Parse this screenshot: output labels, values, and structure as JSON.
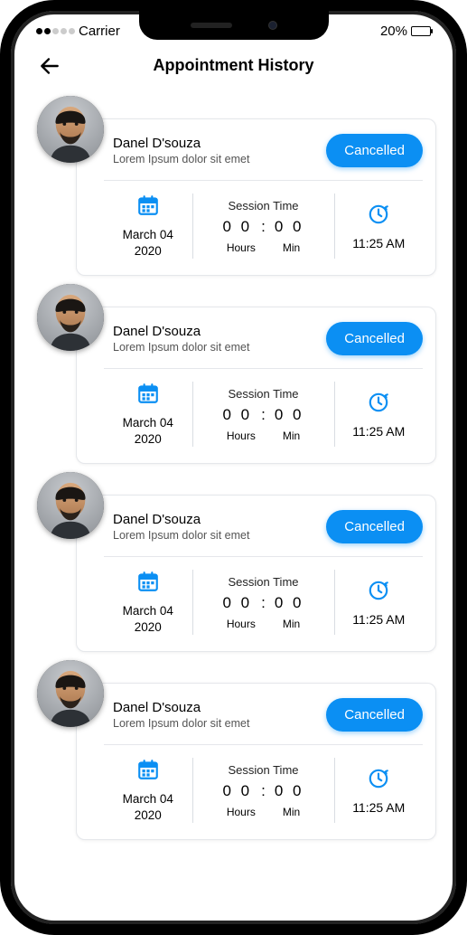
{
  "status": {
    "carrier": "Carrier",
    "battery_pct": "20%",
    "battery_fill_pct": 20
  },
  "header": {
    "title": "Appointment History"
  },
  "labels": {
    "session_time": "Session Time",
    "hours": "Hours",
    "min": "Min"
  },
  "appointments": [
    {
      "name": "Danel D'souza",
      "subtitle": "Lorem Ipsum dolor sit emet",
      "status": "Cancelled",
      "date_line1": "March 04",
      "date_line2": "2020",
      "hh": "0 0",
      "mm": "0 0",
      "time": "11:25 AM"
    },
    {
      "name": "Danel D'souza",
      "subtitle": "Lorem Ipsum dolor sit emet",
      "status": "Cancelled",
      "date_line1": "March 04",
      "date_line2": "2020",
      "hh": "0 0",
      "mm": "0 0",
      "time": "11:25 AM"
    },
    {
      "name": "Danel D'souza",
      "subtitle": "Lorem Ipsum dolor sit emet",
      "status": "Cancelled",
      "date_line1": "March 04",
      "date_line2": "2020",
      "hh": "0 0",
      "mm": "0 0",
      "time": "11:25 AM"
    },
    {
      "name": "Danel D'souza",
      "subtitle": "Lorem Ipsum dolor sit emet",
      "status": "Cancelled",
      "date_line1": "March 04",
      "date_line2": "2020",
      "hh": "0 0",
      "mm": "0 0",
      "time": "11:25 AM"
    }
  ]
}
